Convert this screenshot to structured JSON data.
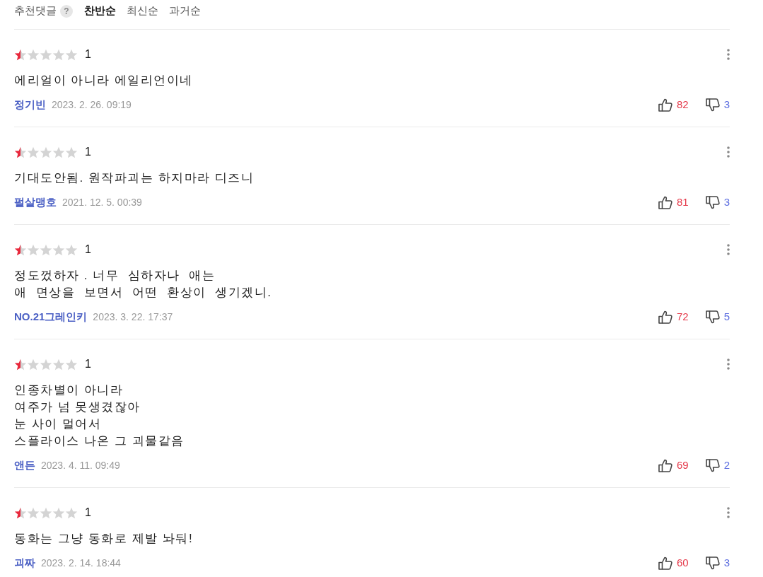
{
  "header": {
    "label": "추천댓글",
    "help": "?",
    "sort_tabs": [
      {
        "label": "찬반순",
        "selected": true
      },
      {
        "label": "최신순",
        "selected": false
      },
      {
        "label": "과거순",
        "selected": false
      }
    ]
  },
  "comments": [
    {
      "stars": 0.5,
      "rating": "1",
      "lines": [
        "에리얼이 아니라 에일리언이네"
      ],
      "author": "정기빈",
      "date": "2023. 2. 26. 09:19",
      "likes": "82",
      "dislikes": "3"
    },
    {
      "stars": 0.5,
      "rating": "1",
      "lines": [
        "기대도안됨. 원작파괴는 하지마라 디즈니"
      ],
      "author": "펄살맹호",
      "date": "2021. 12. 5. 00:39",
      "likes": "81",
      "dislikes": "3"
    },
    {
      "stars": 0.5,
      "rating": "1",
      "lines": [
        "정도껐하자 . 너무  심하자나  애는",
        "애  면상을  보면서  어떤  환상이  생기겠니."
      ],
      "author": "NO.21그레인키",
      "date": "2023. 3. 22. 17:37",
      "likes": "72",
      "dislikes": "5"
    },
    {
      "stars": 0.5,
      "rating": "1",
      "lines": [
        "인종차별이 아니라",
        "여주가 넘 못생겼잖아",
        "눈 사이 멀어서",
        "스플라이스 나온 그 괴물같음"
      ],
      "author": "앤든",
      "date": "2023. 4. 11. 09:49",
      "likes": "69",
      "dislikes": "2"
    },
    {
      "stars": 0.5,
      "rating": "1",
      "lines": [
        "동화는 그냥 동화로 제발 놔둬!"
      ],
      "author": "괴짜",
      "date": "2023. 2. 14. 18:44",
      "likes": "60",
      "dislikes": "3"
    }
  ]
}
